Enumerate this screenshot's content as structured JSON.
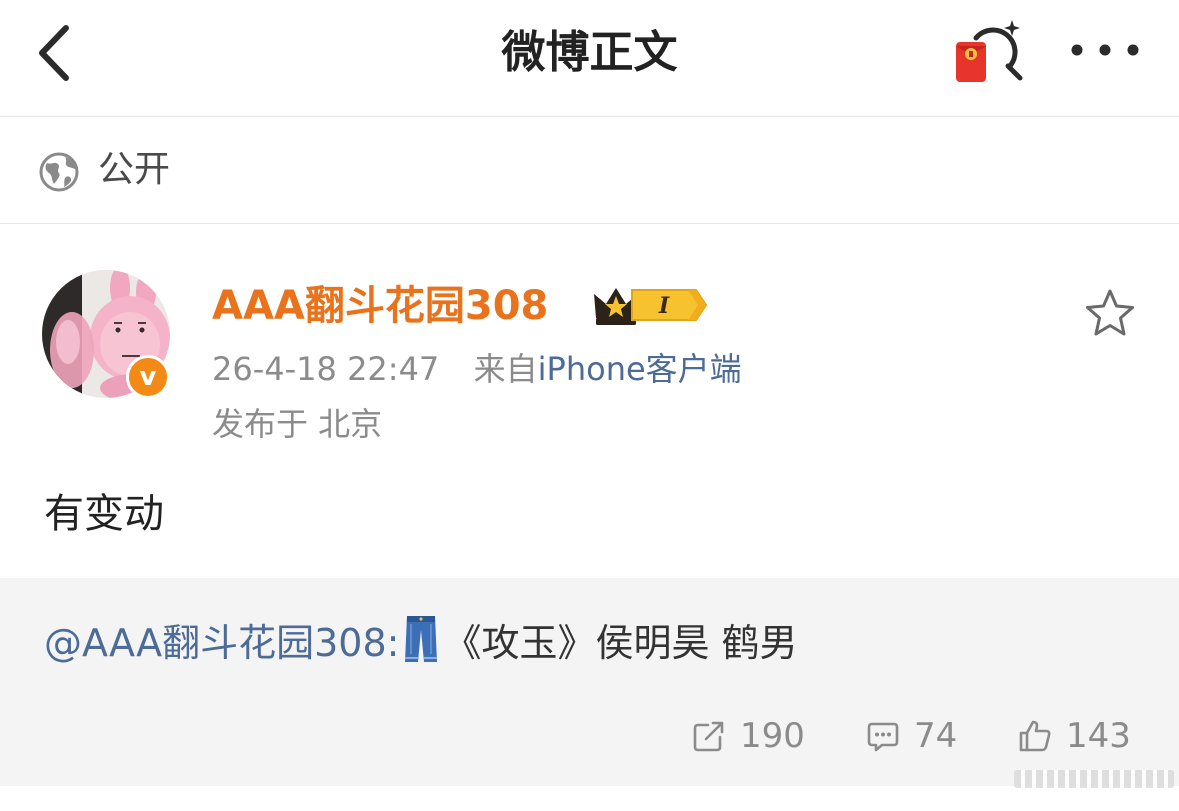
{
  "header": {
    "title": "微博正文",
    "back_icon": "chevron-left-icon",
    "redpacket_icon": "red-packet-search-icon",
    "more_icon": "more-dots-icon"
  },
  "visibility": {
    "icon": "globe-icon",
    "label": "公开"
  },
  "post": {
    "author": "AAA翻斗花园308",
    "member_badge_text": "I",
    "verified_mark": "v",
    "time": "26-4-18 22:47",
    "source_prefix": "来自",
    "source": "iPhone客户端",
    "location": "发布于 北京",
    "text": "有变动"
  },
  "repost": {
    "author": "@AAA翻斗花园308:",
    "text": "《攻玉》侯明昊 鹤男",
    "emoji_icon": "jeans-icon",
    "stats": {
      "reposts": "190",
      "comments": "74",
      "likes": "143"
    }
  },
  "colors": {
    "username": "#e8731c",
    "link": "#4c6b96",
    "muted": "#8b8b8b",
    "repost_bg": "#f4f4f4",
    "verified": "#f28a15"
  }
}
